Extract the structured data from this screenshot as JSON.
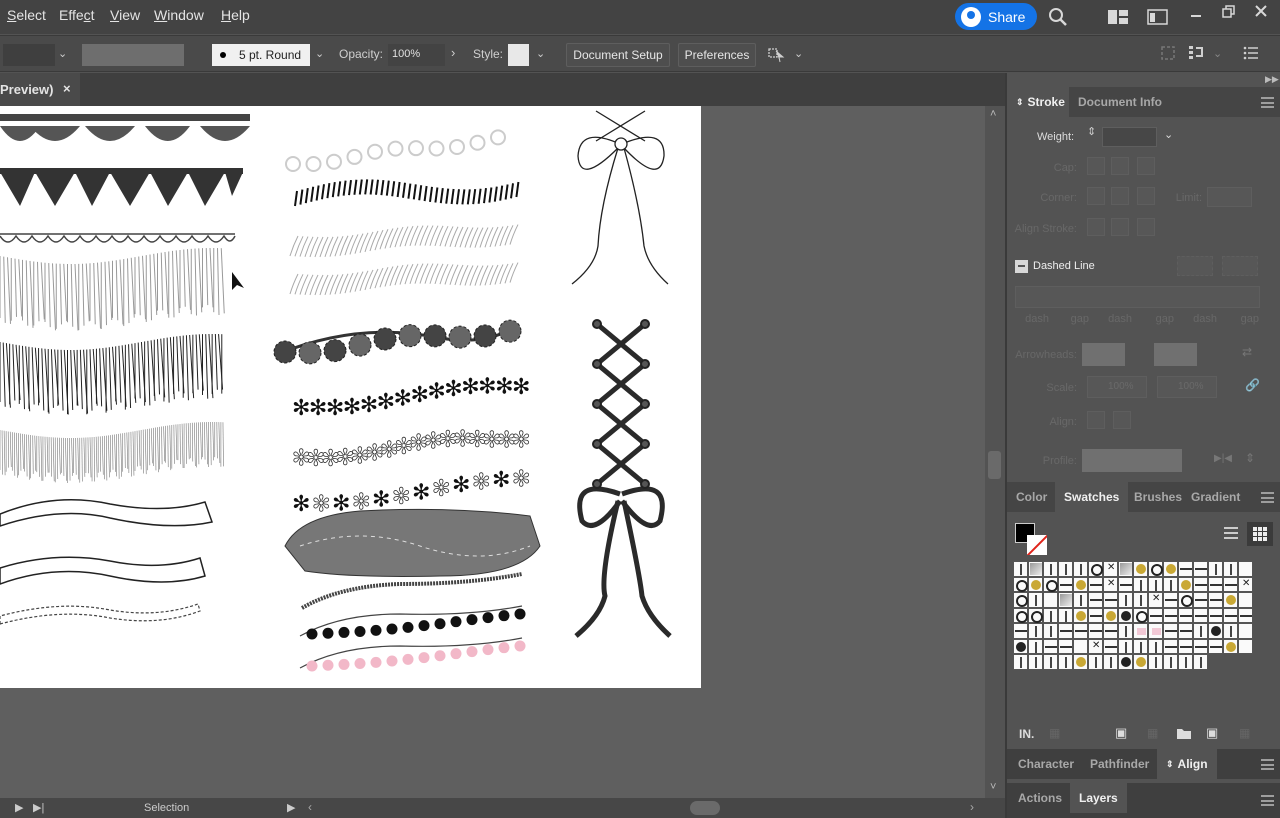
{
  "menubar": {
    "items": [
      {
        "label": "Select",
        "accel": "S"
      },
      {
        "label": "Effect",
        "accel": "c"
      },
      {
        "label": "View",
        "accel": "V"
      },
      {
        "label": "Window",
        "accel": "W"
      },
      {
        "label": "Help",
        "accel": "H"
      }
    ],
    "share_label": "Share",
    "icons": [
      "search-icon",
      "arrange-documents-icon",
      "workspace-icon",
      "minimize-icon",
      "restore-icon",
      "close-icon"
    ]
  },
  "controlbar": {
    "brush_label": "5 pt. Round",
    "opacity_label": "Opacity:",
    "opacity_value": "100%",
    "style_label": "Style:",
    "document_setup_label": "Document Setup",
    "preferences_label": "Preferences"
  },
  "document_tab": {
    "title": "Preview)",
    "close": "×"
  },
  "artboard": {
    "brush_samples": [
      "scalloped-lace-border",
      "triangle-lace-border",
      "scallop-trim",
      "light-fringe",
      "dark-fringe",
      "fine-fringe",
      "ruffle-1",
      "ruffle-2",
      "ruffle-3",
      "rope-top",
      "lace-circles",
      "eyelash-fringe-dark",
      "eyelash-fringe-light-1",
      "eyelash-fringe-light-2",
      "flower-garland",
      "black-flower-chain",
      "outline-flower-chain",
      "mixed-flower-chain",
      "lace-band",
      "stitched-cord",
      "black-pompom-trim",
      "pink-pompom-trim",
      "white-lace-bow",
      "black-corset-lacing"
    ]
  },
  "statusbar": {
    "tool_label": "Selection"
  },
  "panels": {
    "stroke_tabs": [
      {
        "label": "Stroke",
        "active": true
      },
      {
        "label": "Document Info",
        "active": false
      }
    ],
    "stroke": {
      "weight_label": "Weight:",
      "cap_label": "Cap:",
      "corner_label": "Corner:",
      "limit_label": "Limit:",
      "align_stroke_label": "Align Stroke:",
      "dashed_line_label": "Dashed Line",
      "dash_labels": [
        "dash",
        "gap",
        "dash",
        "gap",
        "dash",
        "gap"
      ],
      "arrowheads_label": "Arrowheads:",
      "scale_label": "Scale:",
      "scale_start": "100%",
      "scale_end": "100%",
      "align_label": "Align:",
      "profile_label": "Profile:"
    },
    "swatch_tabs": [
      {
        "label": "Color",
        "active": false
      },
      {
        "label": "Swatches",
        "active": true
      },
      {
        "label": "Brushes",
        "active": false
      },
      {
        "label": "Gradient",
        "active": false
      }
    ],
    "bottom_tabs_1": [
      {
        "label": "Character",
        "active": false
      },
      {
        "label": "Pathfinder",
        "active": false
      },
      {
        "label": "Align",
        "active": true
      }
    ],
    "bottom_tabs_2": [
      {
        "label": "Actions",
        "active": false
      },
      {
        "label": "Layers",
        "active": true
      }
    ]
  },
  "colors": {
    "accent": "#1473e6",
    "ui_dark": "#434343",
    "panel": "#535353",
    "canvas": "#5f5f5f",
    "artboard": "#ffffff"
  }
}
